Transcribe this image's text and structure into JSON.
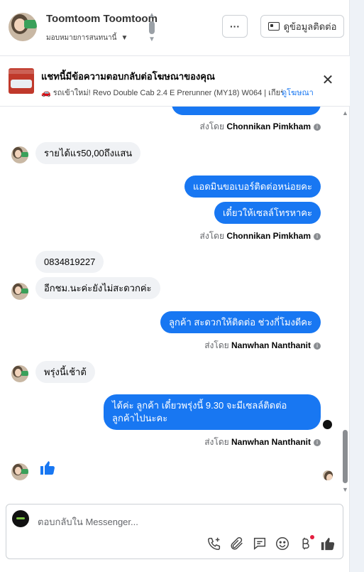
{
  "header": {
    "contact_name": "Toomtoom Toomtoom",
    "assign_label": "มอบหมายการสนทนานี้",
    "more_label": "···",
    "contact_info_label": "ดูข้อมูลติดต่อ"
  },
  "ad_banner": {
    "title": "แชทนี้มีข้อความตอบกลับต่อโฆษณาของคุณ",
    "subtitle": "🚗 รถเข้าใหม่! Revo Double Cab 2.4 E Prerunner (MY18) W064 | เกียร์อ...",
    "link": "ดูโฆษณา",
    "close": "✕"
  },
  "messages": [
    {
      "id": "m0",
      "dir": "out",
      "text": "",
      "sent_by_prefix": "ส่งโดย",
      "sent_by": "Chonnikan Pimkham"
    },
    {
      "id": "m1",
      "dir": "in",
      "text": "รายได้แร50,00ถึงแสน"
    },
    {
      "id": "m2",
      "dir": "out",
      "text": "แอดมินขอเบอร์ติดต่อหน่อยคะ"
    },
    {
      "id": "m3",
      "dir": "out",
      "text": "เดี๋ยวให้เซลล์โทรหาคะ",
      "sent_by_prefix": "ส่งโดย",
      "sent_by": "Chonnikan Pimkham"
    },
    {
      "id": "m4",
      "dir": "in",
      "text": "0834819227"
    },
    {
      "id": "m5",
      "dir": "in",
      "text": "อีกชม.นะค่ะยังไม่สะดวกค่ะ"
    },
    {
      "id": "m6",
      "dir": "out",
      "text": "ลูกค้า สะดวกให้ติดต่อ ช่วงกี่โมงดีคะ",
      "sent_by_prefix": "ส่งโดย",
      "sent_by": "Nanwhan Nanthanit"
    },
    {
      "id": "m7",
      "dir": "in",
      "text": "พรุ่งนี้เช้าต้"
    },
    {
      "id": "m8",
      "dir": "out",
      "line1": "ได้ค่ะ  ลูกค้า เดี๋ยวพรุ่งนี้ 9.30 จะมีเซลล์ติดต่อ",
      "line2": "ลูกค้าไปนะคะ",
      "sent_by_prefix": "ส่งโดย",
      "sent_by": "Nanwhan Nanthanit"
    },
    {
      "id": "m9",
      "dir": "in",
      "type": "like-sticker"
    }
  ],
  "info_icon": "i",
  "composer": {
    "placeholder": "ตอบกลับใน Messenger..."
  },
  "colors": {
    "outgoing_bubble": "#1877f2",
    "incoming_bubble": "#f0f2f5",
    "link": "#1877f2",
    "notification_dot": "#e41e3f"
  }
}
